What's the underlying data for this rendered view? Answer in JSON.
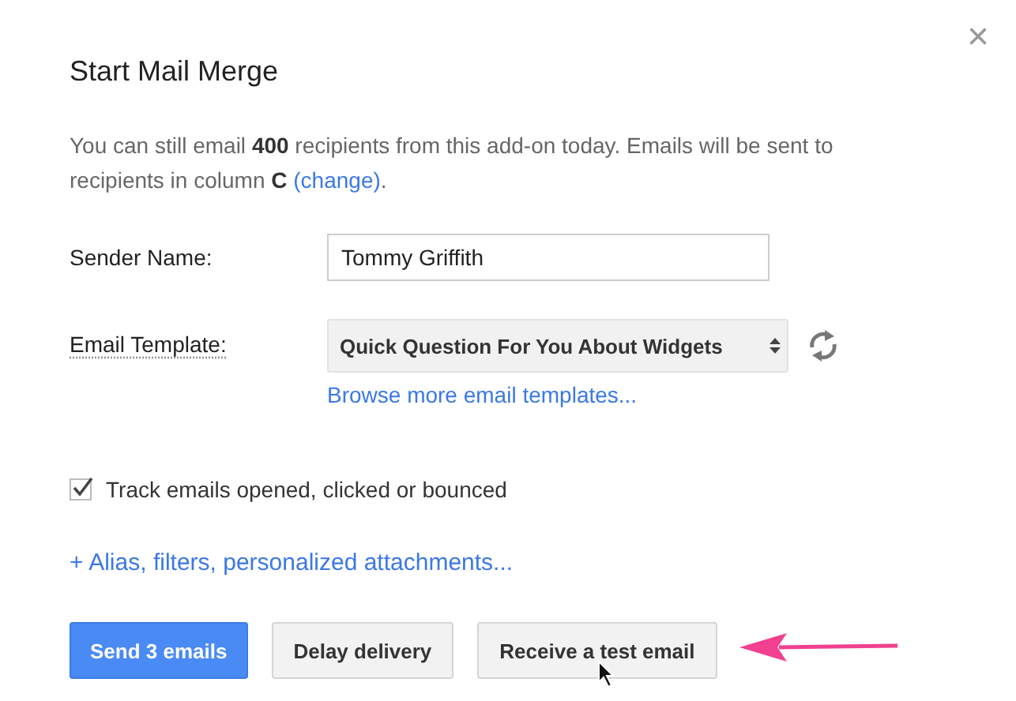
{
  "dialog": {
    "title": "Start Mail Merge",
    "close": "×"
  },
  "notice": {
    "text": "You can still email **400** recipients from this add-on today. Emails will be sent to recipients in column **C**",
    "link": "(change)",
    "end": "."
  },
  "sender": {
    "label": "Sender Name:",
    "value": "Tommy Griffith"
  },
  "template": {
    "label": "Email Template:",
    "value": "Quick Question For You About Widgets",
    "link": "Browse more email templates..."
  },
  "tracking": {
    "label": "Track emails opened, clicked or bounced",
    "checked": true
  },
  "options_link": "+ Alias, filters, personalized attachments...",
  "buttons": [
    {
      "label": "Send 3 emails",
      "kind": "primary"
    },
    {
      "label": "Delay delivery",
      "kind": "secondary"
    },
    {
      "label": "Receive a test email",
      "kind": "secondary"
    }
  ]
}
